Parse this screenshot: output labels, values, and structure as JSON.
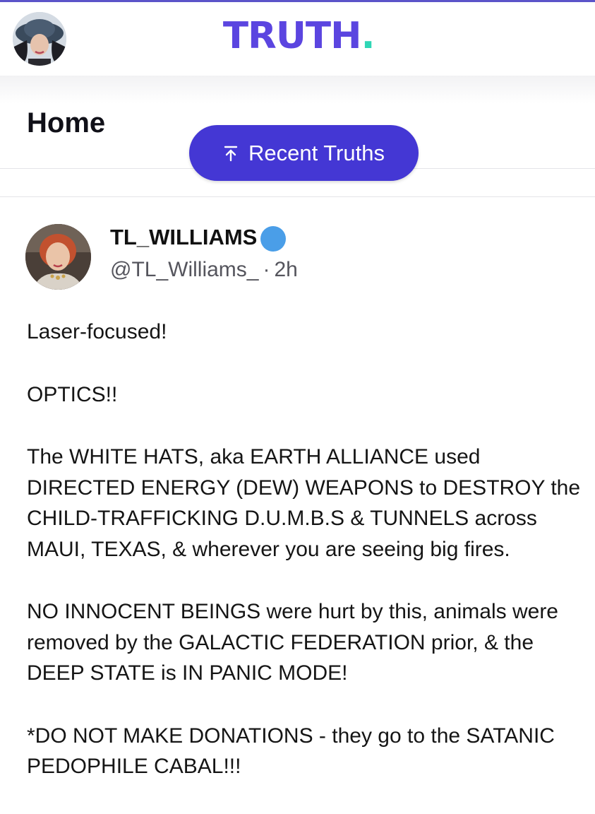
{
  "header": {
    "logo_text": "TRUTH",
    "logo_dot": ".",
    "brand_color": "#5b45e0",
    "accent_color": "#2fd6b5"
  },
  "page": {
    "title": "Home"
  },
  "recent_button": {
    "label": "Recent Truths",
    "icon": "arrow-up-to-line-icon",
    "color": "#4437d4"
  },
  "post": {
    "display_name": "TL_WILLIAMS",
    "verified_icon": "verified-badge-icon",
    "handle": "@TL_Williams_",
    "separator": "·",
    "time": "2h",
    "paragraphs": [
      "Laser-focused!",
      "OPTICS!!",
      "The WHITE HATS, aka EARTH ALLIANCE used DIRECTED ENERGY (DEW) WEAPONS to DESTROY the CHILD-TRAFFICKING D.U.M.B.S & TUNNELS across MAUI, TEXAS, & wherever you are seeing big fires.",
      "NO INNOCENT BEINGS were hurt by this, animals were removed by the GALACTIC FEDERATION prior, & the DEEP STATE is IN PANIC MODE!",
      "*DO NOT MAKE DONATIONS - they go to the SATANIC PEDOPHILE CABAL!!!"
    ]
  }
}
